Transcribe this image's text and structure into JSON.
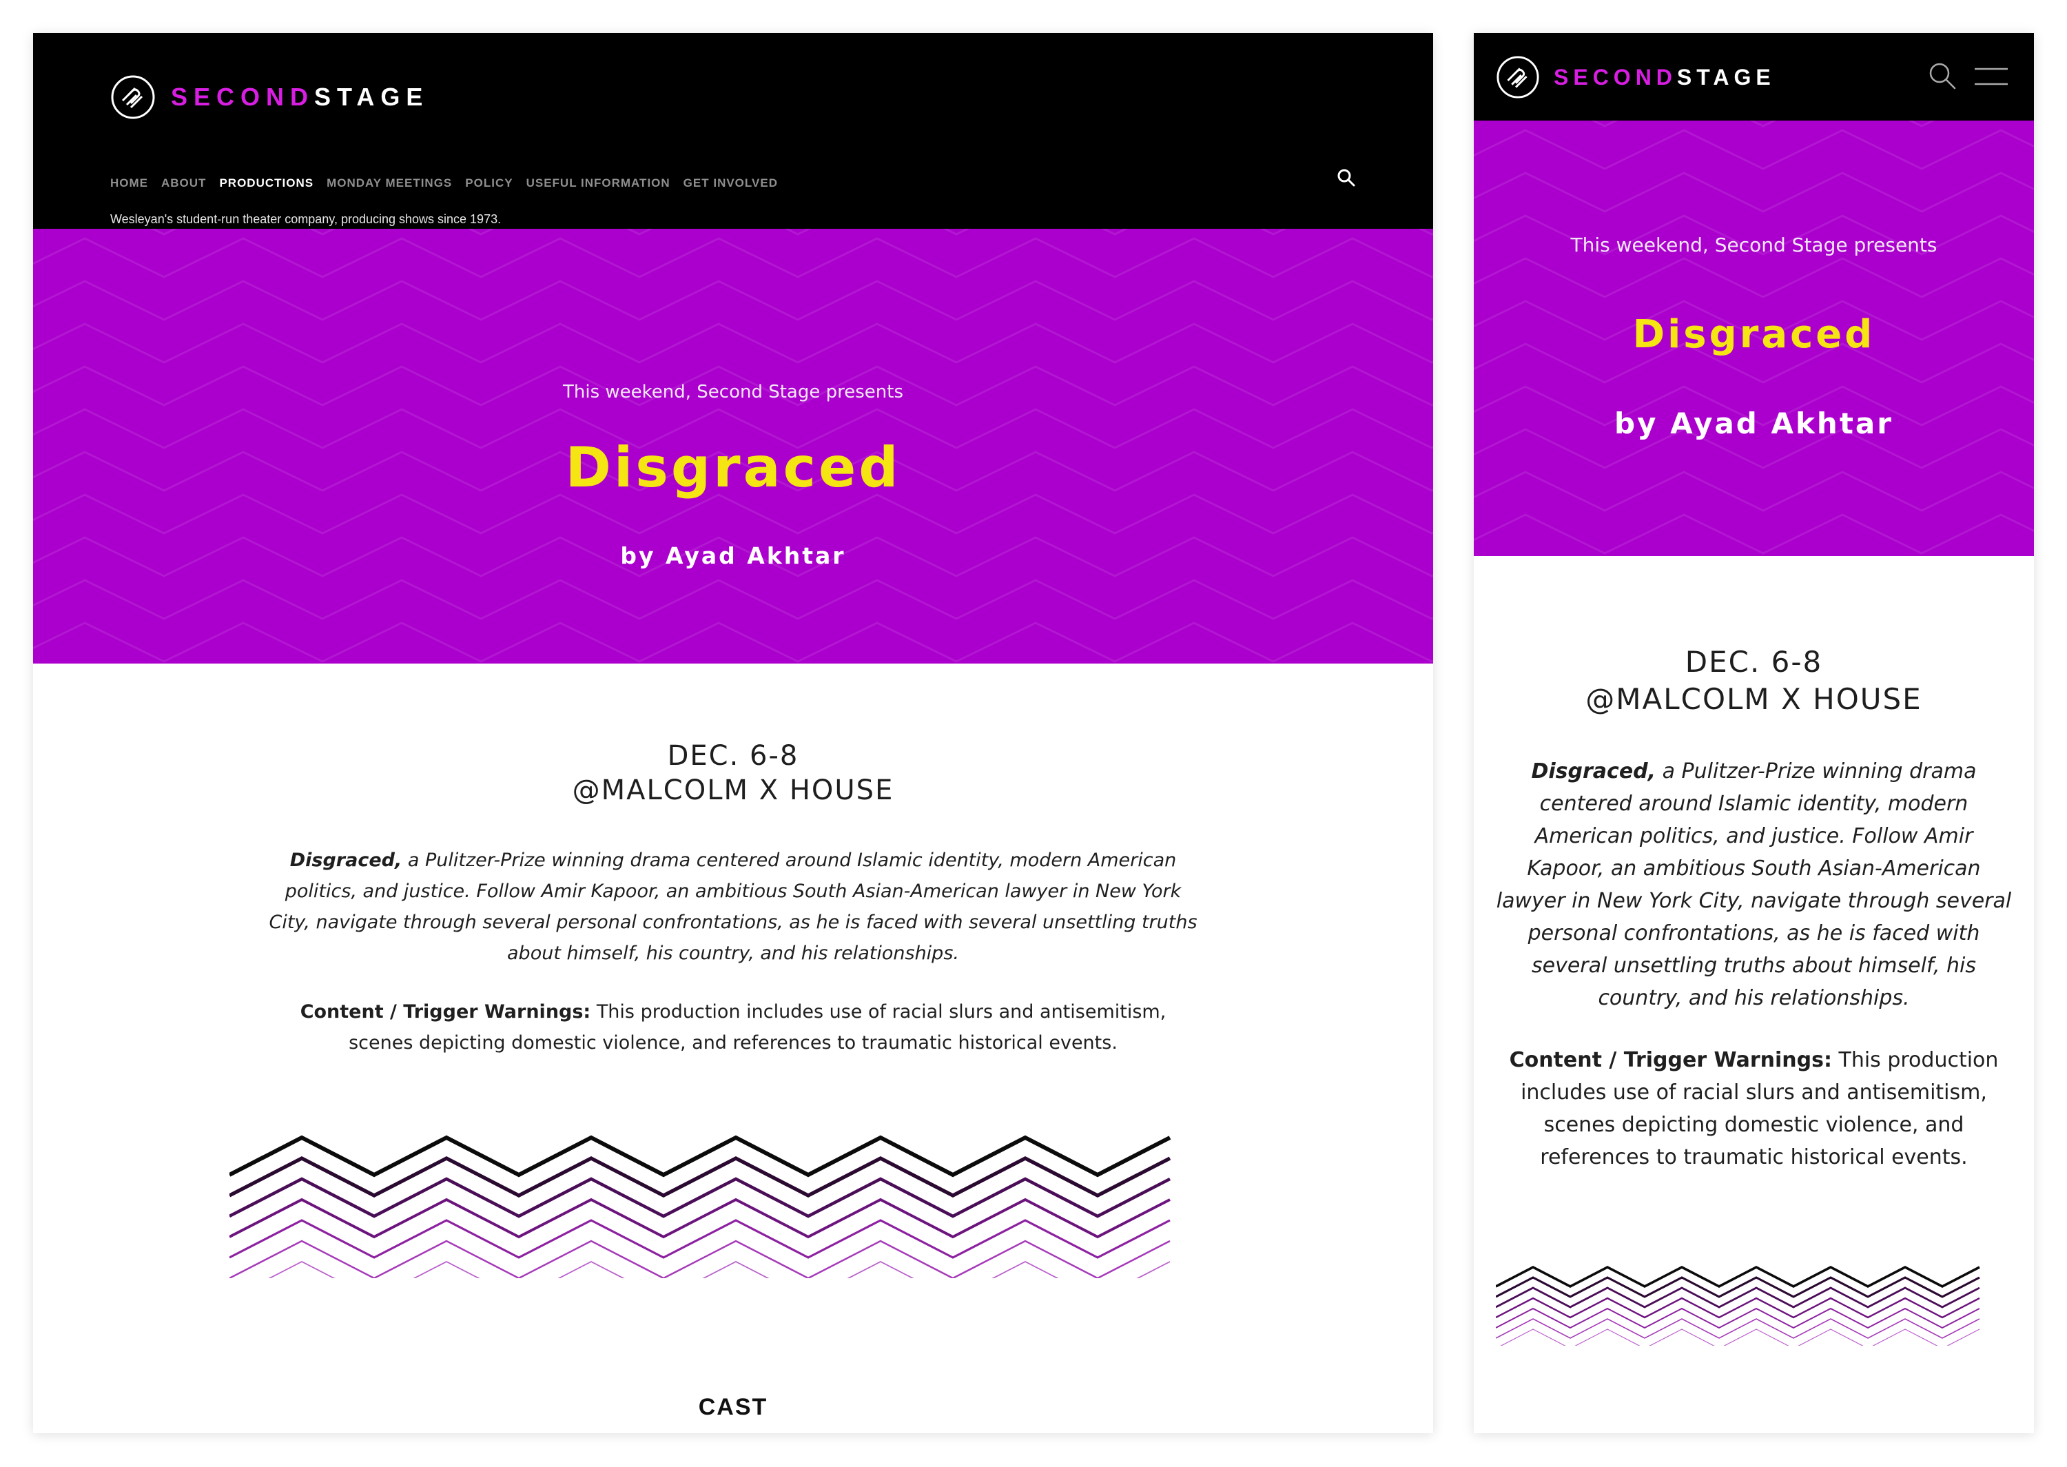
{
  "brand": {
    "name_part1": "SECOND",
    "name_part2": "STAGE",
    "accent_color": "#d91ee3",
    "hero_color": "#ab00cd",
    "title_color": "#f4e513"
  },
  "nav": {
    "items": [
      {
        "label": "HOME",
        "active": false
      },
      {
        "label": "ABOUT",
        "active": false
      },
      {
        "label": "PRODUCTIONS",
        "active": true
      },
      {
        "label": "MONDAY MEETINGS",
        "active": false
      },
      {
        "label": "POLICY",
        "active": false
      },
      {
        "label": "USEFUL INFORMATION",
        "active": false
      },
      {
        "label": "GET INVOLVED",
        "active": false
      }
    ],
    "tagline": "Wesleyan's student-run theater company, producing shows since 1973.",
    "search_icon": "search-icon",
    "menu_icon": "hamburger-menu-icon"
  },
  "hero": {
    "pretitle": "This weekend, Second Stage presents",
    "title": "Disgraced",
    "byline": "by Ayad Akhtar"
  },
  "event": {
    "date": "DEC. 6-8",
    "venue": "@MALCOLM X HOUSE"
  },
  "description": {
    "lead": "Disgraced,",
    "body": " a Pulitzer-Prize winning drama centered around Islamic identity, modern American politics, and justice. Follow Amir Kapoor, an ambitious South Asian-American lawyer in New York City, navigate through several personal confrontations, as he is faced with several unsettling truths about himself, his country, and his relationships."
  },
  "warnings": {
    "label": "Content / Trigger Warnings:",
    "text": " This production includes use of racial slurs and antisemitism, scenes depicting domestic violence, and references to traumatic historical events."
  },
  "cast": {
    "heading": "CAST"
  }
}
